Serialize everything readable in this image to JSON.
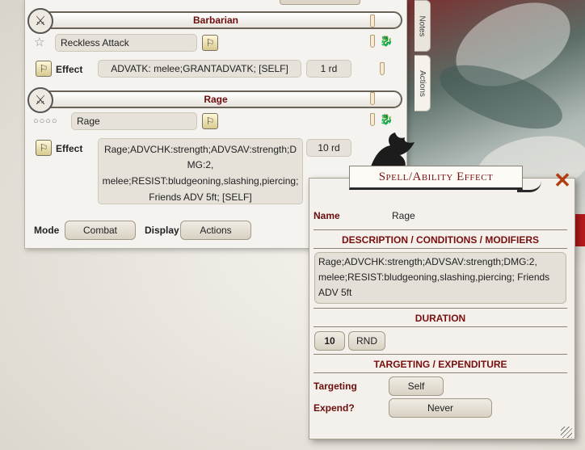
{
  "sheet": {
    "tabs": {
      "notes": "Notes",
      "actions": "Actions"
    },
    "barbarian_section": {
      "title": "Barbarian",
      "power_name": "Reckless Attack",
      "effect_label": "Effect",
      "effect_value": "ADVATK: melee;GRANTADVATK; [SELF]",
      "effect_duration": "1 rd"
    },
    "rage_section": {
      "title": "Rage",
      "uses_marker": "○○○○",
      "power_name": "Rage",
      "effect_label": "Effect",
      "effect_lines": [
        "Rage;ADVCHK:strength;ADVSAV:strength;D",
        "MG:2,",
        "melee;RESIST:bludgeoning,slashing,piercing;",
        "Friends ADV 5ft; [SELF]"
      ],
      "effect_duration": "10 rd"
    },
    "footer": {
      "mode_label": "Mode",
      "mode_value": "Combat",
      "display_label": "Display",
      "display_value": "Actions"
    }
  },
  "effect_window": {
    "title": "Spell/Ability Effect",
    "name_label": "Name",
    "name_value": "Rage",
    "desc_header": "DESCRIPTION / CONDITIONS / MODIFIERS",
    "desc_lines": [
      "Rage;ADVCHK:strength;ADVSAV:strength;DMG:2,",
      "melee;RESIST:bludgeoning,slashing,piercing; Friends",
      "ADV 5ft"
    ],
    "duration_header": "DURATION",
    "duration_value": "10",
    "duration_unit": "RND",
    "targeting_header": "TARGETING / EXPENDITURE",
    "targeting_label": "Targeting",
    "targeting_value": "Self",
    "expend_label": "Expend?",
    "expend_value": "Never"
  },
  "colors": {
    "accent_red": "#6b0d0d",
    "close_orange": "#b23c12",
    "panel_bg": "#f5f3ef"
  }
}
